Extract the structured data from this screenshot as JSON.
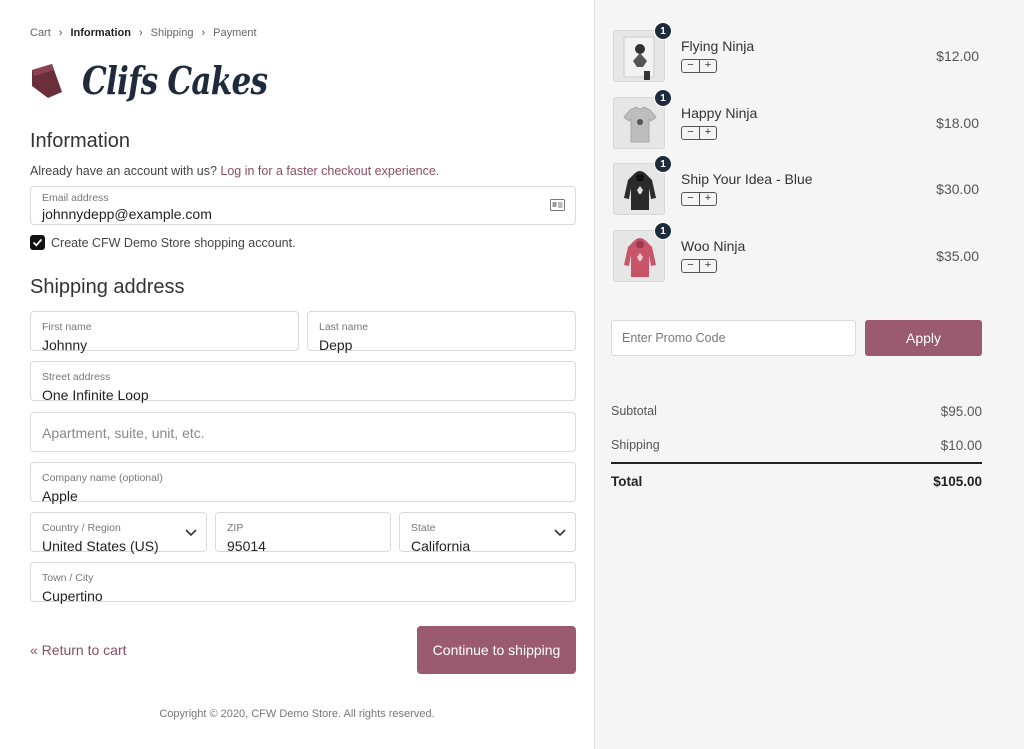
{
  "breadcrumb": [
    {
      "label": "Cart"
    },
    {
      "label": "Information"
    },
    {
      "label": "Shipping"
    },
    {
      "label": "Payment"
    }
  ],
  "brand": {
    "name": "Clifs Cakes",
    "color": "#1f2a3c",
    "mark_color": "#6b2f3c"
  },
  "information": {
    "heading": "Information",
    "account_prompt": "Already have an account with us?",
    "login_link": "Log in for a faster checkout experience.",
    "email_label": "Email address",
    "email_value": "johnnydepp@example.com",
    "create_account_label": "Create CFW Demo Store shopping account.",
    "create_account_checked": true
  },
  "shipping": {
    "heading": "Shipping address",
    "first_name_label": "First name",
    "first_name_value": "Johnny",
    "last_name_label": "Last name",
    "last_name_value": "Depp",
    "street_label": "Street address",
    "street_value": "One Infinite Loop",
    "apartment_placeholder": "Apartment, suite, unit, etc.",
    "company_label": "Company name (optional)",
    "company_value": "Apple",
    "country_label": "Country / Region",
    "country_value": "United States (US)",
    "zip_label": "ZIP",
    "zip_value": "95014",
    "state_label": "State",
    "state_value": "California",
    "city_label": "Town / City",
    "city_value": "Cupertino"
  },
  "actions": {
    "return_label": "« Return to cart",
    "continue_label": "Continue to shipping"
  },
  "footer": {
    "copyright": "Copyright © 2020, CFW Demo Store. All rights reserved."
  },
  "cart": {
    "items": [
      {
        "name": "Flying Ninja",
        "qty": "1",
        "price": "$12.00",
        "icon": "poster-ninja-icon"
      },
      {
        "name": "Happy Ninja",
        "qty": "1",
        "price": "$18.00",
        "icon": "tshirt-icon"
      },
      {
        "name": "Ship Your Idea - Blue",
        "qty": "1",
        "price": "$30.00",
        "icon": "hoodie-icon"
      },
      {
        "name": "Woo Ninja",
        "qty": "1",
        "price": "$35.00",
        "icon": "hoodie-icon"
      }
    ],
    "stepper_minus": "−",
    "stepper_plus": "+",
    "promo_placeholder": "Enter Promo Code",
    "apply_label": "Apply",
    "subtotal_label": "Subtotal",
    "subtotal_value": "$95.00",
    "shipping_label": "Shipping",
    "shipping_value": "$10.00",
    "total_label": "Total",
    "total_value": "$105.00"
  },
  "colors": {
    "accent": "#9a5a6f",
    "link": "#8b4d63",
    "badge": "#1e2b3d",
    "sidebar_bg": "#f5f5f5"
  }
}
